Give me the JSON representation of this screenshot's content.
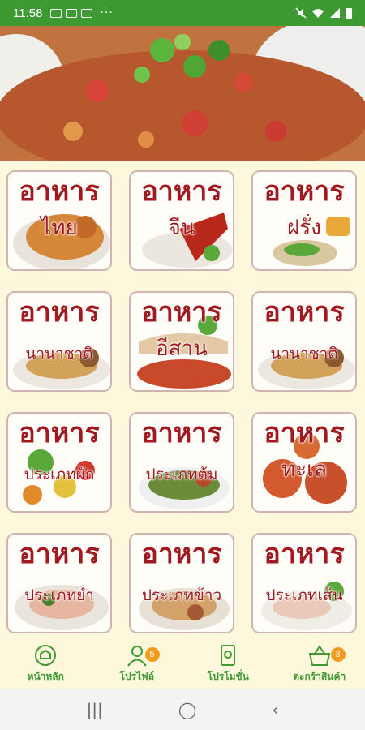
{
  "status_bar": {
    "time": "11:58",
    "dots": "···"
  },
  "categories": [
    {
      "line1": "อาหาร",
      "line2": "ไทย"
    },
    {
      "line1": "อาหาร",
      "line2": "จีน"
    },
    {
      "line1": "อาหาร",
      "line2": "ฝรั่ง"
    },
    {
      "line1": "อาหาร",
      "line2": "นานาชาติ"
    },
    {
      "line1": "อาหาร",
      "line2": "อีสาน"
    },
    {
      "line1": "อาหาร",
      "line2": "นานาชาติ"
    },
    {
      "line1": "อาหาร",
      "line2": "ประเภทผัก"
    },
    {
      "line1": "อาหาร",
      "line2": "ประเภทต้ม"
    },
    {
      "line1": "อาหาร",
      "line2": "ทะเล"
    },
    {
      "line1": "อาหาร",
      "line2": "ประเภทยำ"
    },
    {
      "line1": "อาหาร",
      "line2": "ประเภทข้าว"
    },
    {
      "line1": "อาหาร",
      "line2": "ประเภทเส้น"
    }
  ],
  "bottom_nav": {
    "home": {
      "label": "หน้าหลัก",
      "icon": "home-icon"
    },
    "profile": {
      "label": "โปรไฟล์",
      "icon": "profile-icon",
      "badge": "5"
    },
    "promotion": {
      "label": "โปรโมชั่น",
      "icon": "promotion-icon"
    },
    "cart": {
      "label": "ตะกร้าสินค้า",
      "icon": "basket-icon",
      "badge": "3"
    }
  },
  "colors": {
    "status_bar": "#3d9a33",
    "accent_green": "#3e9a31",
    "title_red": "#a01a1f",
    "badge": "#f29c1f",
    "background": "#fdf7dc"
  }
}
